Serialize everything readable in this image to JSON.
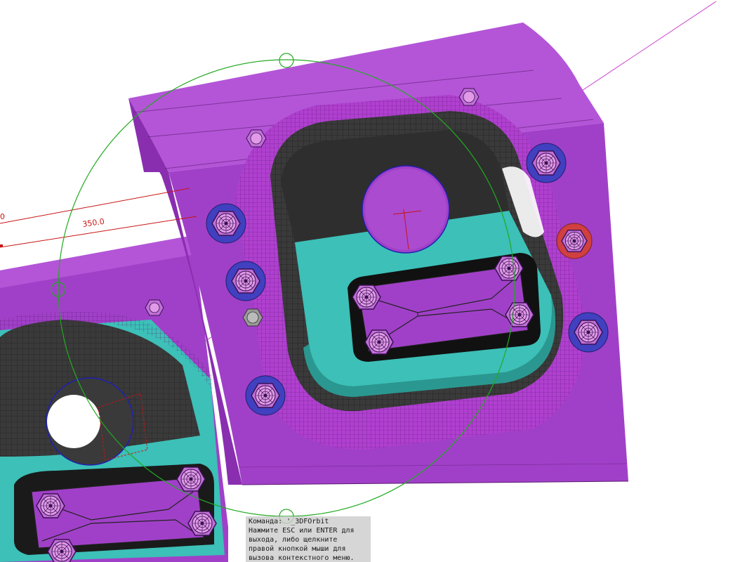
{
  "viewport": {
    "dimensions": {
      "partial_label": "0",
      "main_label": "350.0"
    }
  },
  "command_line": {
    "lines": [
      "Команда: '_3DFOrbit",
      "Нажмите ESC или ENTER для",
      "выхода, либо щелкните",
      "правой кнопкой мыши для",
      "вызова контекстного меню."
    ]
  },
  "colors": {
    "body": "#a040c8",
    "body_dark": "#8a2eb0",
    "body_light": "#b455d8",
    "teal": "#3cc0b8",
    "teal_dark": "#2a9890",
    "cavity": "#3a3a3a",
    "bolt": "#d58ae0",
    "bolt_blue": "#4040c0",
    "bolt_red": "#d04040",
    "orbit": "#22aa22",
    "dimension": "#c81414",
    "axis": "#cc44cc"
  },
  "icons": {
    "orbit_handles": "circle-handle-icon",
    "bolts": "hex-bolt-icon"
  }
}
